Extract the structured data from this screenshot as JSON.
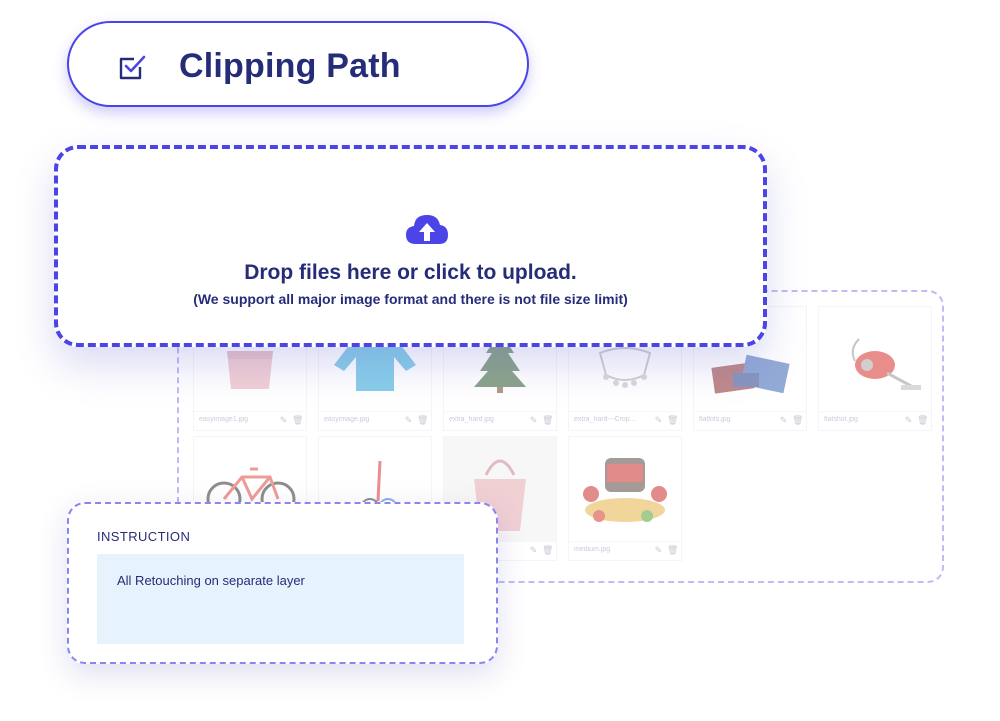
{
  "service": {
    "title": "Clipping Path",
    "checked": true,
    "icon": "checkbox-checked-icon"
  },
  "upload": {
    "icon": "cloud-upload-icon",
    "main_text": "Drop files here or click to upload.",
    "sub_text": "(We support all major image format and there is not file size limit)"
  },
  "gallery": {
    "items": [
      {
        "name": "easyimage1.jpg",
        "subject": "pink handbag"
      },
      {
        "name": "easyimage.jpg",
        "subject": "blue blouse"
      },
      {
        "name": "extra_hard.jpg",
        "subject": "christmas tree"
      },
      {
        "name": "extra_hard---Crop...",
        "subject": "chandelier"
      },
      {
        "name": "flatlots.jpg",
        "subject": "clothing flat lay"
      },
      {
        "name": "flatshot.jpg",
        "subject": "vacuum cleaner"
      },
      {
        "name": "",
        "subject": "red bicycle"
      },
      {
        "name": "",
        "subject": "badminton rackets"
      },
      {
        "name": "",
        "subject": "pink tote bag"
      },
      {
        "name": "medium.jpg",
        "subject": "slow cooker set"
      }
    ]
  },
  "instruction": {
    "label": "INSTRUCTION",
    "text": "All Retouching on separate layer"
  },
  "colors": {
    "accent": "#4b44e6",
    "text": "#262d78",
    "instruction_bg": "#e6f2fc"
  }
}
